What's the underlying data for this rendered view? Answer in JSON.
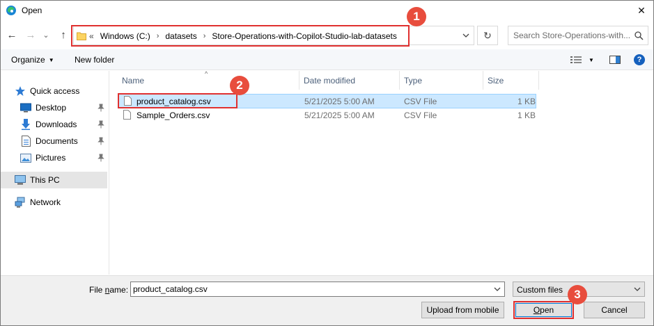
{
  "window": {
    "title": "Open",
    "close_glyph": "✕"
  },
  "navigation": {
    "back_glyph": "←",
    "forward_glyph": "→",
    "recent_glyph": "⌄",
    "up_glyph": "↑",
    "address": {
      "overflow": "«",
      "crumbs": [
        "Windows (C:)",
        "datasets",
        "Store-Operations-with-Copilot-Studio-lab-datasets"
      ],
      "separator": "›"
    },
    "refresh_glyph": "↻",
    "search_placeholder": "Search Store-Operations-with..."
  },
  "toolbar": {
    "organize_label": "Organize",
    "new_folder_label": "New folder",
    "help_glyph": "?"
  },
  "sidebar": {
    "items": [
      {
        "label": "Quick access",
        "icon": "star-icon"
      },
      {
        "label": "Desktop",
        "icon": "desktop-icon",
        "pinned": true
      },
      {
        "label": "Downloads",
        "icon": "downloads-icon",
        "pinned": true
      },
      {
        "label": "Documents",
        "icon": "documents-icon",
        "pinned": true
      },
      {
        "label": "Pictures",
        "icon": "pictures-icon",
        "pinned": true
      },
      {
        "label": "This PC",
        "icon": "computer-icon",
        "selected": true
      },
      {
        "label": "Network",
        "icon": "network-icon"
      }
    ]
  },
  "filelist": {
    "columns": [
      "Name",
      "Date modified",
      "Type",
      "Size"
    ],
    "sort_glyph": "^",
    "rows": [
      {
        "name": "product_catalog.csv",
        "date": "5/21/2025 5:00 AM",
        "type": "CSV File",
        "size": "1 KB",
        "selected": true
      },
      {
        "name": "Sample_Orders.csv",
        "date": "5/21/2025 5:00 AM",
        "type": "CSV File",
        "size": "1 KB",
        "selected": false
      }
    ]
  },
  "footer": {
    "file_name_label_pre": "File ",
    "file_name_label_underlined": "n",
    "file_name_label_post": "ame:",
    "file_name_value": "product_catalog.csv",
    "file_type_value": "Custom files",
    "upload_mobile_label": "Upload from mobile",
    "open_label_underlined": "O",
    "open_label_rest": "pen",
    "cancel_label": "Cancel"
  },
  "callouts": [
    "1",
    "2",
    "3"
  ],
  "colors": {
    "callout_red": "#e84d3d",
    "highlight_border": "#e0302f",
    "selection_bg": "#cce8ff",
    "header_text": "#4c607a"
  }
}
